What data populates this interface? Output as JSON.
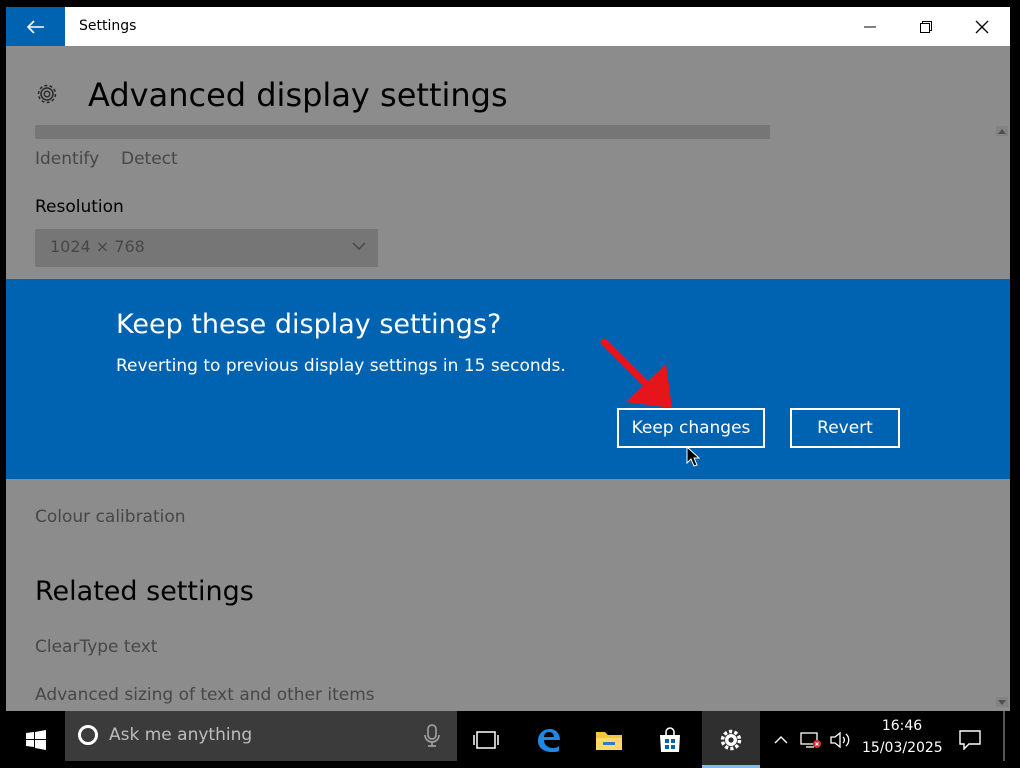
{
  "window": {
    "title": "Settings"
  },
  "page": {
    "title": "Advanced display settings",
    "links": [
      "Identify",
      "Detect"
    ],
    "resolution_label": "Resolution",
    "resolution_value": "1024 × 768",
    "colour_calibration": "Colour calibration",
    "related_title": "Related settings",
    "related_links": [
      "ClearType text",
      "Advanced sizing of text and other items"
    ]
  },
  "dialog": {
    "title": "Keep these display settings?",
    "message": "Reverting to previous display settings in 15 seconds.",
    "keep_label": "Keep changes",
    "revert_label": "Revert"
  },
  "taskbar": {
    "search_placeholder": "Ask me anything",
    "time": "16:46",
    "date": "15/03/2025"
  },
  "colors": {
    "accent": "#0063b1",
    "annotation_arrow": "#e8141c"
  },
  "icons": [
    "back-arrow-icon",
    "minimize-icon",
    "restore-icon",
    "close-icon",
    "gear-icon",
    "chevron-down-icon",
    "windows-start-icon",
    "cortana-icon",
    "microphone-icon",
    "task-view-icon",
    "edge-icon",
    "file-explorer-icon",
    "store-icon",
    "settings-icon",
    "chevron-up-icon",
    "network-icon",
    "volume-icon",
    "action-center-icon",
    "mouse-cursor-icon"
  ]
}
